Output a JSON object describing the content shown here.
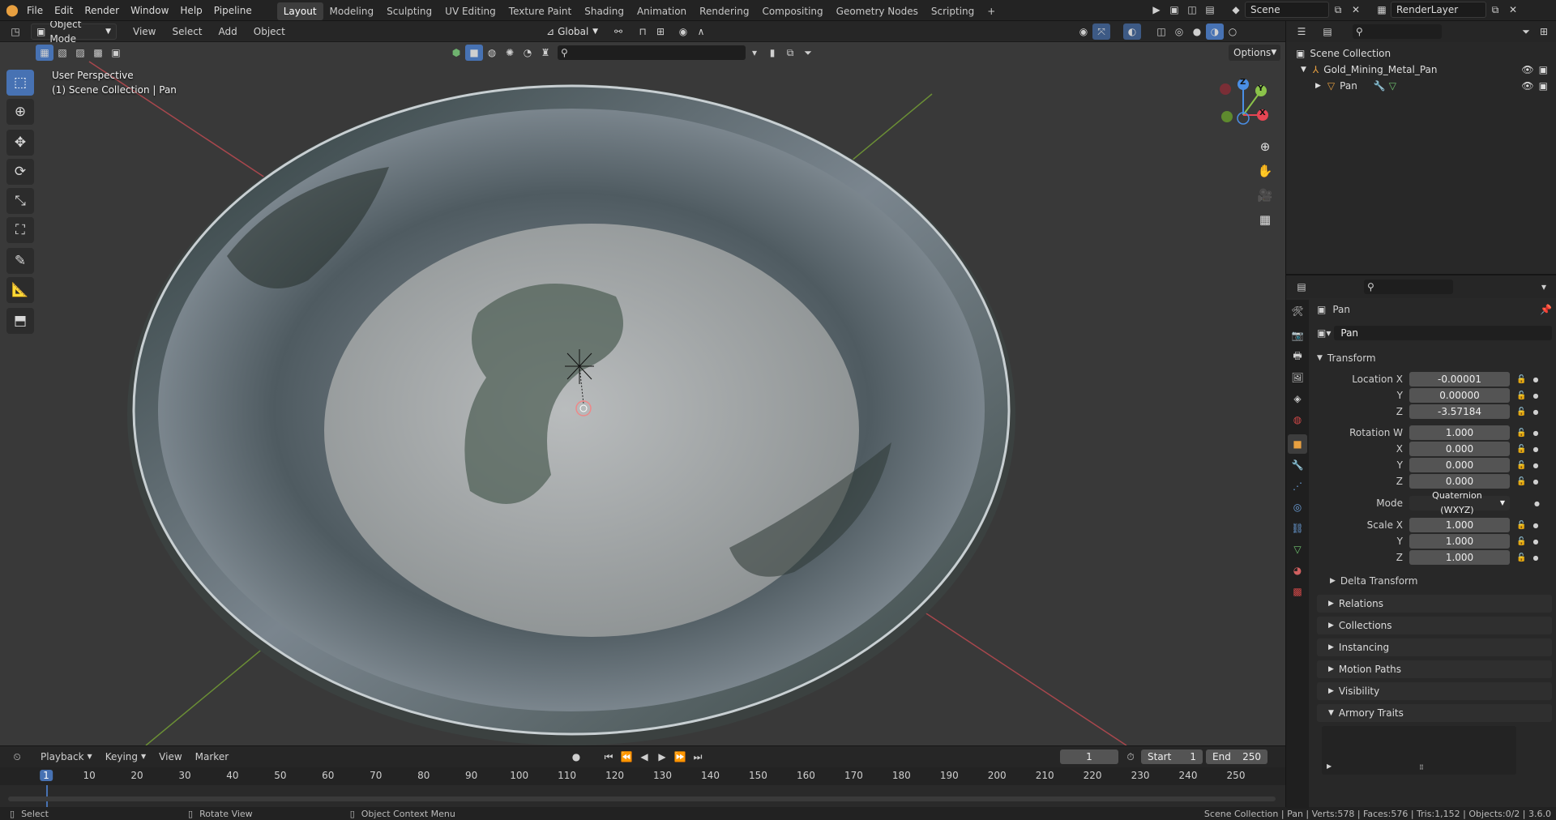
{
  "menu": [
    "File",
    "Edit",
    "Render",
    "Window",
    "Help",
    "Pipeline"
  ],
  "workspaces": [
    "Layout",
    "Modeling",
    "Sculpting",
    "UV Editing",
    "Texture Paint",
    "Shading",
    "Animation",
    "Rendering",
    "Compositing",
    "Geometry Nodes",
    "Scripting",
    "+"
  ],
  "active_workspace": "Layout",
  "scene_name": "Scene",
  "render_layer": "RenderLayer",
  "viewport": {
    "mode": "Object Mode",
    "menus": [
      "View",
      "Select",
      "Add",
      "Object"
    ],
    "transform_orientation": "Global",
    "options_label": "Options",
    "overlay_line1": "User Perspective",
    "overlay_line2": "(1) Scene Collection | Pan",
    "gizmo_axes": {
      "z": "Z",
      "y": "Y",
      "x": "X"
    }
  },
  "outliner": {
    "root": "Scene Collection",
    "items": [
      {
        "name": "Gold_Mining_Metal_Pan",
        "icon": "empty-icon",
        "indent": 1
      },
      {
        "name": "Pan",
        "icon": "mesh-icon",
        "indent": 2
      }
    ]
  },
  "properties": {
    "object_name": "Pan",
    "datablock_name": "Pan",
    "transform_title": "Transform",
    "location": {
      "label": "Location X",
      "x": "-0.00001",
      "y": "0.00000",
      "z": "-3.57184"
    },
    "rotation": {
      "label": "Rotation W",
      "w": "1.000",
      "x": "0.000",
      "y": "0.000",
      "z": "0.000"
    },
    "mode": {
      "label": "Mode",
      "value": "Quaternion (WXYZ)"
    },
    "scale": {
      "label": "Scale X",
      "x": "1.000",
      "y": "1.000",
      "z": "1.000"
    },
    "axis_labels": {
      "y": "Y",
      "z": "Z",
      "x": "X"
    },
    "subpanels": [
      "Delta Transform"
    ],
    "panels": [
      "Relations",
      "Collections",
      "Instancing",
      "Motion Paths",
      "Visibility",
      "Armory Traits"
    ]
  },
  "timeline": {
    "menus": [
      "Playback",
      "Keying",
      "View",
      "Marker"
    ],
    "current_frame": "1",
    "start_label": "Start",
    "start": "1",
    "end_label": "End",
    "end": "250",
    "ticks": [
      "1",
      "10",
      "20",
      "30",
      "40",
      "50",
      "60",
      "70",
      "80",
      "90",
      "100",
      "110",
      "120",
      "130",
      "140",
      "150",
      "160",
      "170",
      "180",
      "190",
      "200",
      "210",
      "220",
      "230",
      "240",
      "250"
    ]
  },
  "status": {
    "left": "Select",
    "middle": "Rotate View",
    "right_hint": "Object Context Menu",
    "stats": "Scene Collection | Pan | Verts:578 | Faces:576 | Tris:1,152 | Objects:0/2 | 3.6.0"
  },
  "colors": {
    "accent": "#4772b3",
    "x_axis": "#e64553",
    "y_axis": "#8bc34a",
    "z_axis": "#4a8fe6"
  }
}
